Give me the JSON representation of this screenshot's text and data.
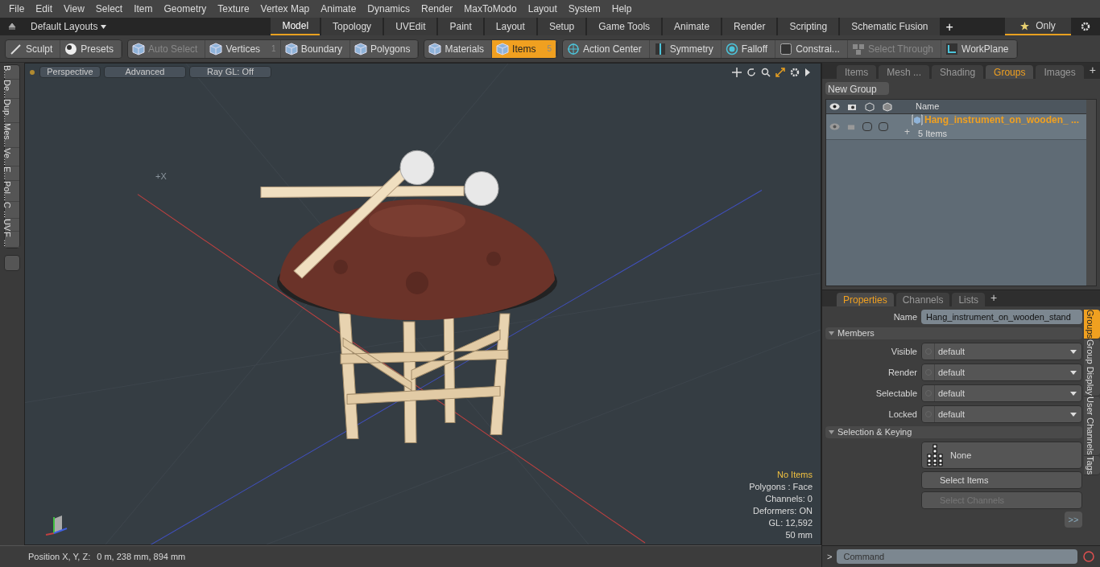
{
  "menu": [
    "File",
    "Edit",
    "View",
    "Select",
    "Item",
    "Geometry",
    "Texture",
    "Vertex Map",
    "Animate",
    "Dynamics",
    "Render",
    "MaxToModo",
    "Layout",
    "System",
    "Help"
  ],
  "layout_bar": {
    "layouts": "Default Layouts",
    "tabs": [
      {
        "label": "Model",
        "selected": true
      },
      {
        "label": "Topology",
        "selected": false
      },
      {
        "label": "UVEdit",
        "selected": false
      },
      {
        "label": "Paint",
        "selected": false
      },
      {
        "label": "Layout",
        "selected": false
      },
      {
        "label": "Setup",
        "selected": false
      },
      {
        "label": "Game Tools",
        "selected": false
      },
      {
        "label": "Animate",
        "selected": false
      },
      {
        "label": "Render",
        "selected": false
      },
      {
        "label": "Scripting",
        "selected": false
      },
      {
        "label": "Schematic Fusion",
        "selected": false
      }
    ],
    "add": "+",
    "only": {
      "label": "Only",
      "selected": true
    }
  },
  "toolbar": [
    [
      {
        "label": "Sculpt",
        "kind": "pen",
        "disabled": false,
        "selected": false
      },
      {
        "label": "Presets",
        "kind": "sphere",
        "disabled": false,
        "selected": false
      }
    ],
    [
      {
        "label": "Auto Select",
        "kind": "cube",
        "disabled": true,
        "selected": false
      },
      {
        "label": "Vertices",
        "kind": "cube",
        "disabled": false,
        "selected": false,
        "count": "1"
      },
      {
        "label": "Boundary",
        "kind": "cube",
        "disabled": false,
        "selected": false
      },
      {
        "label": "Polygons",
        "kind": "cube",
        "disabled": false,
        "selected": false
      }
    ],
    [
      {
        "label": "Materials",
        "kind": "cube",
        "disabled": false,
        "selected": false
      },
      {
        "label": "Items",
        "kind": "cube",
        "disabled": false,
        "selected": true,
        "count": "5"
      }
    ],
    [
      {
        "label": "Action Center",
        "kind": "target",
        "disabled": false,
        "selected": false
      },
      {
        "label": "Symmetry",
        "kind": "bar",
        "disabled": false,
        "selected": false
      },
      {
        "label": "Falloff",
        "kind": "ring",
        "disabled": false,
        "selected": false
      },
      {
        "label": "Constrai...",
        "kind": "square",
        "disabled": false,
        "selected": false
      },
      {
        "label": "Select Through",
        "kind": "cubes",
        "disabled": true,
        "selected": false
      },
      {
        "label": "WorkPlane",
        "kind": "plane",
        "disabled": false,
        "selected": false
      }
    ]
  ],
  "side_tabs": [
    "B...",
    "De...",
    "Dup...",
    "Mes...",
    "Ve...",
    "E...",
    "Pol...",
    "C ...",
    "UV",
    "F ..."
  ],
  "viewport": {
    "buttons": [
      "Perspective",
      "Advanced",
      "Ray GL: Off"
    ],
    "axis_label": "+X",
    "hud": [
      {
        "text": "No Items",
        "kind": "warning"
      },
      {
        "text": "Polygons : Face",
        "kind": "info"
      },
      {
        "text": "Channels: 0",
        "kind": "info"
      },
      {
        "text": "Deformers: ON",
        "kind": "info"
      },
      {
        "text": "GL: 12,592",
        "kind": "info"
      },
      {
        "text": "50 mm",
        "kind": "info"
      }
    ]
  },
  "status_bar": {
    "label": "Position X, Y, Z:",
    "value": "0 m, 238 mm, 894 mm"
  },
  "groups_panel": {
    "tabs": [
      {
        "label": "Items",
        "selected": false
      },
      {
        "label": "Mesh ...",
        "selected": false
      },
      {
        "label": "Shading",
        "selected": false
      },
      {
        "label": "Groups",
        "selected": true
      },
      {
        "label": "Images",
        "selected": false
      }
    ],
    "add": "+",
    "new_group": "New Group",
    "column": "Name",
    "rows": [
      {
        "name": "Hang_instrument_on_wooden_ ...",
        "count": "5 Items",
        "selected": true,
        "expand": "+"
      }
    ]
  },
  "properties": {
    "tabs": [
      {
        "label": "Properties",
        "selected": true
      },
      {
        "label": "Channels",
        "selected": false
      },
      {
        "label": "Lists",
        "selected": false
      }
    ],
    "add": "+",
    "name_label": "Name",
    "name_value": "Hang_instrument_on_wooden_stand",
    "members": {
      "title": "Members",
      "fields": [
        {
          "label": "Visible",
          "value": "default"
        },
        {
          "label": "Render",
          "value": "default"
        },
        {
          "label": "Selectable",
          "value": "default"
        },
        {
          "label": "Locked",
          "value": "default"
        }
      ]
    },
    "selection": {
      "title": "Selection & Keying",
      "preset": "None",
      "buttons": [
        {
          "label": "Select Items",
          "disabled": false
        },
        {
          "label": "Select Channels",
          "disabled": true
        }
      ]
    },
    "more": ">>",
    "side_tabs": [
      {
        "label": "Groups",
        "selected": true
      },
      {
        "label": "Group Display",
        "selected": false
      },
      {
        "label": "User Channels",
        "selected": false
      },
      {
        "label": "Tags",
        "selected": false
      }
    ]
  },
  "command": {
    "prompt": ">",
    "placeholder": "Command"
  }
}
